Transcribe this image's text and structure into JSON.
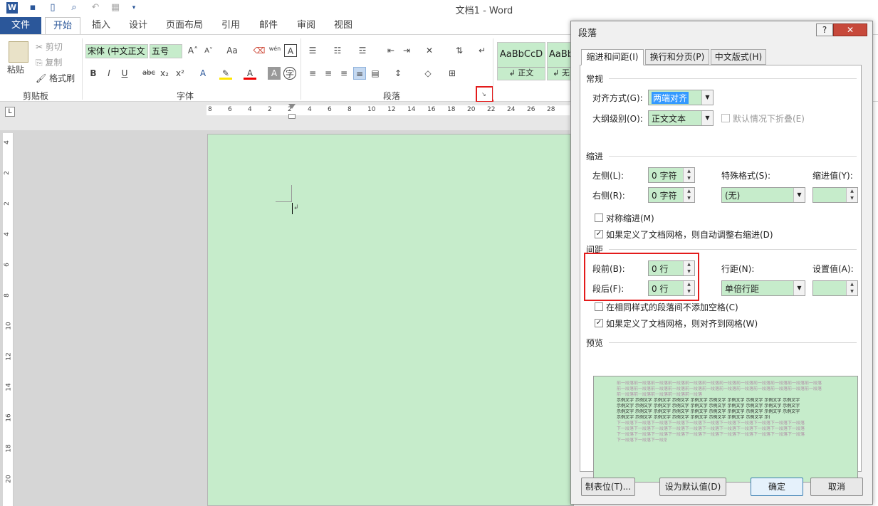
{
  "window": {
    "title": "文档1 - Word"
  },
  "ribbon_tabs": [
    "文件",
    "开始",
    "插入",
    "设计",
    "页面布局",
    "引用",
    "邮件",
    "审阅",
    "视图"
  ],
  "clipboard": {
    "paste": "粘贴",
    "cut": "剪切",
    "copy": "复制",
    "format_painter": "格式刷",
    "group": "剪贴板"
  },
  "font": {
    "name": "宋体 (中文正文",
    "size": "五号",
    "group": "字体",
    "bold": "B",
    "italic": "I",
    "underline": "U",
    "strike": "abc",
    "sub": "x₂",
    "sup": "x²",
    "aa": "Aa",
    "pinyin": "wén",
    "boxed": "A"
  },
  "paragraph_group": {
    "group": "段落"
  },
  "styles": {
    "items": [
      "AaBbCcD",
      "AaBb"
    ],
    "names": [
      "正文",
      "无"
    ]
  },
  "ruler": {
    "h_ticks": [
      "8",
      "6",
      "4",
      "2",
      "2",
      "4",
      "6",
      "8",
      "10",
      "12",
      "14",
      "16",
      "18",
      "20",
      "22",
      "24",
      "26",
      "28"
    ],
    "v_ticks": [
      "4",
      "2",
      "2",
      "4",
      "6",
      "8",
      "10",
      "12",
      "14",
      "16",
      "18",
      "20"
    ]
  },
  "dialog": {
    "title": "段落",
    "help": "?",
    "close": "✕",
    "tabs": [
      "缩进和间距(I)",
      "换行和分页(P)",
      "中文版式(H)"
    ],
    "general": {
      "heading": "常规",
      "align_label": "对齐方式(G):",
      "align_value": "两端对齐",
      "outline_label": "大纲级别(O):",
      "outline_value": "正文文本",
      "collapse_label": "默认情况下折叠(E)"
    },
    "indent": {
      "heading": "缩进",
      "left_label": "左侧(L):",
      "left_value": "0 字符",
      "right_label": "右侧(R):",
      "right_value": "0 字符",
      "special_label": "特殊格式(S):",
      "special_value": "(无)",
      "by_label": "缩进值(Y):",
      "mirror_label": "对称缩进(M)",
      "grid_label": "如果定义了文档网格，则自动调整右缩进(D)"
    },
    "spacing": {
      "heading": "间距",
      "before_label": "段前(B):",
      "before_value": "0 行",
      "after_label": "段后(F):",
      "after_value": "0 行",
      "line_label": "行距(N):",
      "line_value": "单倍行距",
      "at_label": "设置值(A):",
      "nospace_label": "在相同样式的段落间不添加空格(C)",
      "snap_label": "如果定义了文档网格，则对齐到网格(W)"
    },
    "preview": {
      "heading": "预览",
      "prev_line": "前一段落前一段落前一段落前一段落前一段落前一段落前一段落前一段落前一段落前一段落前一段落前一段落",
      "sample_line": "示例文字 示例文字 示例文字 示例文字 示例文字 示例文字 示例文字 示例文字 示例文字 示例文字",
      "next_line": "下一段落下一段落下一段落下一段落下一段落下一段落下一段落下一段落下一段落下一段落下一段落"
    },
    "buttons": {
      "tabs": "制表位(T)...",
      "default": "设为默认值(D)",
      "ok": "确定",
      "cancel": "取消"
    }
  },
  "checks": {
    "mirror": false,
    "grid_right": true,
    "nospace": false,
    "snap": true,
    "collapse": false
  }
}
